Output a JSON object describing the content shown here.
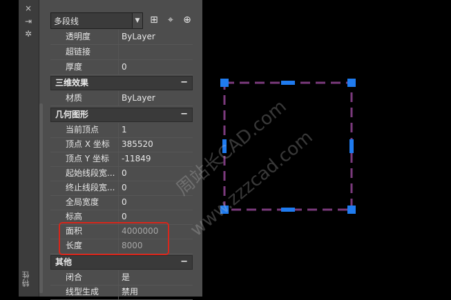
{
  "titlebar": {
    "close_icon": "×",
    "auto_hide_icon": "⇥",
    "settings_icon": "✲",
    "title": "特性"
  },
  "toolbar": {
    "object_type": "多段线",
    "quick_select_icon": "⊞",
    "select_objects_icon": "⌖",
    "toggle_pickadd_icon": "⊕"
  },
  "rows": {
    "transparency": {
      "label": "透明度",
      "value": "ByLayer"
    },
    "hyperlink": {
      "label": "超链接",
      "value": ""
    },
    "thickness": {
      "label": "厚度",
      "value": "0"
    },
    "material": {
      "label": "材质",
      "value": "ByLayer"
    },
    "current_vertex": {
      "label": "当前顶点",
      "value": "1"
    },
    "vertex_x": {
      "label": "顶点 X 坐标",
      "value": "385520"
    },
    "vertex_y": {
      "label": "顶点 Y 坐标",
      "value": "-11849"
    },
    "start_width": {
      "label": "起始线段宽...",
      "value": "0"
    },
    "end_width": {
      "label": "终止线段宽...",
      "value": "0"
    },
    "global_width": {
      "label": "全局宽度",
      "value": "0"
    },
    "elevation": {
      "label": "标高",
      "value": "0"
    },
    "area": {
      "label": "面积",
      "value": "4000000"
    },
    "length": {
      "label": "长度",
      "value": "8000"
    },
    "closed": {
      "label": "闭合",
      "value": "是"
    },
    "linetype_gen": {
      "label": "线型生成",
      "value": "禁用"
    }
  },
  "categories": {
    "3d": {
      "label": "三维效果",
      "toggle": "−"
    },
    "geometry": {
      "label": "几何图形",
      "toggle": "−"
    },
    "misc": {
      "label": "其他",
      "toggle": "−"
    }
  },
  "watermark": {
    "line1": "周站长CAD.com",
    "line2": "www.zzzcad.com"
  },
  "colors": {
    "polyline": "#7b3a7d",
    "grip": "#1f7bef",
    "highlight": "#d8261b"
  }
}
